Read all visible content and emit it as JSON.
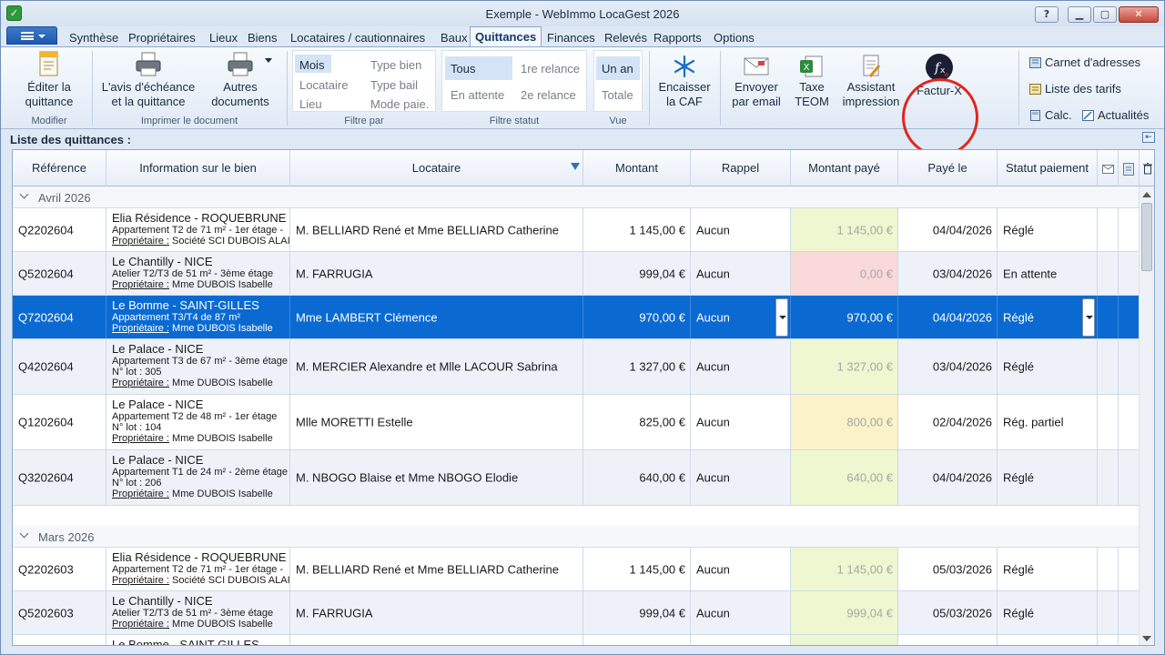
{
  "window": {
    "title": "Exemple - WebImmo LocaGest 2026",
    "help": "?",
    "minimize": "▁",
    "maximize": "▢",
    "close": "✕"
  },
  "tabs": [
    "Synthèse",
    "Propriétaires",
    "Lieux",
    "Biens",
    "Locataires / cautionnaires",
    "Baux",
    "Quittances",
    "Finances",
    "Relevés",
    "Rapports",
    "Options"
  ],
  "active_tab": "Quittances",
  "ribbon": {
    "modifier": {
      "label": "Modifier",
      "edit_l1": "Éditer la",
      "edit_l2": "quittance"
    },
    "imprimer": {
      "label": "Imprimer le document",
      "avis_l1": "L'avis d'échéance",
      "avis_l2": "et la quittance",
      "autres_l1": "Autres",
      "autres_l2": "documents"
    },
    "filtre_par": {
      "label": "Filtre par",
      "mois": "Mois",
      "locataire": "Locataire",
      "lieu": "Lieu",
      "type_bien": "Type bien",
      "type_bail": "Type bail",
      "mode_paie": "Mode paie."
    },
    "filtre_statut": {
      "label": "Filtre statut",
      "tous": "Tous",
      "en_attente": "En attente",
      "relance1": "1re relance",
      "relance2": "2e relance"
    },
    "vue": {
      "label": "Vue",
      "un_an": "Un an",
      "totale": "Totale"
    },
    "caf_l1": "Encaisser",
    "caf_l2": "la CAF",
    "email_l1": "Envoyer",
    "email_l2": "par email",
    "teom_l1": "Taxe",
    "teom_l2": "TEOM",
    "assist_l1": "Assistant",
    "assist_l2": "impression",
    "facturx": "Factur-X",
    "carnet": "Carnet d'adresses",
    "tarifs": "Liste des tarifs",
    "calc": "Calc.",
    "actualites": "Actualités"
  },
  "list_title": "Liste des quittances :",
  "columns": {
    "reference": "Référence",
    "info": "Information sur le bien",
    "locataire": "Locataire",
    "montant": "Montant",
    "rappel": "Rappel",
    "montant_paye": "Montant payé",
    "paye_le": "Payé le",
    "statut": "Statut paiement"
  },
  "groups": [
    {
      "label": "Avril 2026",
      "rows": [
        {
          "ref": "Q2202604",
          "l1": "Elia Résidence - ROQUEBRUNE C",
          "l2": "Appartement T2 de 71 m² - 1er étage -",
          "l3": "",
          "owner_label": "Propriétaire :",
          "owner": "Société SCI DUBOIS ALAI",
          "locataire": "M. BELLIARD René et Mme BELLIARD Catherine",
          "montant": "1 145,00 €",
          "rappel": "Aucun",
          "paye": "1 145,00 €",
          "paye_color": "green",
          "date": "04/04/2026",
          "statut": "Réglé"
        },
        {
          "ref": "Q5202604",
          "l1": "Le Chantilly - NICE",
          "l2": "Atelier T2/T3 de 51 m² - 3ème étage",
          "l3": "",
          "owner_label": "Propriétaire :",
          "owner": "Mme DUBOIS Isabelle",
          "locataire": "M. FARRUGIA",
          "montant": "999,04 €",
          "rappel": "Aucun",
          "paye": "0,00 €",
          "paye_color": "red",
          "date": "03/04/2026",
          "statut": "En attente"
        },
        {
          "ref": "Q7202604",
          "l1": "Le Bomme - SAINT-GILLES",
          "l2": "Appartement T3/T4 de 87 m²",
          "l3": "",
          "owner_label": "Propriétaire :",
          "owner": "Mme DUBOIS Isabelle",
          "locataire": "Mme LAMBERT Clémence",
          "montant": "970,00 €",
          "rappel": "Aucun",
          "paye": "970,00 €",
          "paye_color": "none",
          "date": "04/04/2026",
          "statut": "Réglé",
          "selected": true
        },
        {
          "ref": "Q4202604",
          "l1": "Le Palace - NICE",
          "l2": "Appartement T3 de 67 m² - 3ème étage",
          "l3": "N° lot : 305",
          "owner_label": "Propriétaire :",
          "owner": "Mme DUBOIS Isabelle",
          "locataire": "M. MERCIER Alexandre et Mlle LACOUR Sabrina",
          "montant": "1 327,00 €",
          "rappel": "Aucun",
          "paye": "1 327,00 €",
          "paye_color": "green",
          "date": "03/04/2026",
          "statut": "Réglé"
        },
        {
          "ref": "Q1202604",
          "l1": "Le Palace - NICE",
          "l2": "Appartement T2 de 48 m² - 1er étage",
          "l3": "N° lot : 104",
          "owner_label": "Propriétaire :",
          "owner": "Mme DUBOIS Isabelle",
          "locataire": "Mlle MORETTI Estelle",
          "montant": "825,00 €",
          "rappel": "Aucun",
          "paye": "800,00 €",
          "paye_color": "yellow",
          "date": "02/04/2026",
          "statut": "Rég. partiel"
        },
        {
          "ref": "Q3202604",
          "l1": "Le Palace - NICE",
          "l2": "Appartement T1 de 24 m² - 2ème étage",
          "l3": "N° lot : 206",
          "owner_label": "Propriétaire :",
          "owner": "Mme DUBOIS Isabelle",
          "locataire": "M. NBOGO Blaise et Mme NBOGO Elodie",
          "montant": "640,00 €",
          "rappel": "Aucun",
          "paye": "640,00 €",
          "paye_color": "green",
          "date": "04/04/2026",
          "statut": "Réglé"
        }
      ]
    },
    {
      "label": "Mars 2026",
      "rows": [
        {
          "ref": "Q2202603",
          "l1": "Elia Résidence - ROQUEBRUNE C",
          "l2": "Appartement T2 de 71 m² - 1er étage -",
          "l3": "",
          "owner_label": "Propriétaire :",
          "owner": "Société SCI DUBOIS ALAI",
          "locataire": "M. BELLIARD René et Mme BELLIARD Catherine",
          "montant": "1 145,00 €",
          "rappel": "Aucun",
          "paye": "1 145,00 €",
          "paye_color": "green",
          "date": "05/03/2026",
          "statut": "Réglé"
        },
        {
          "ref": "Q5202603",
          "l1": "Le Chantilly - NICE",
          "l2": "Atelier T2/T3 de 51 m² - 3ème étage",
          "l3": "",
          "owner_label": "Propriétaire :",
          "owner": "Mme DUBOIS Isabelle",
          "locataire": "M. FARRUGIA",
          "montant": "999,04 €",
          "rappel": "Aucun",
          "paye": "999,04 €",
          "paye_color": "green",
          "date": "05/03/2026",
          "statut": "Réglé"
        },
        {
          "ref": "",
          "l1": "Le Bomme - SAINT-GILLES",
          "l2": "",
          "l3": "",
          "owner_label": "",
          "owner": "",
          "locataire": "",
          "montant": "",
          "rappel": "",
          "paye": "",
          "paye_color": "green",
          "date": "",
          "statut": ""
        }
      ]
    }
  ],
  "colors": {
    "accent": "#0a6ad2",
    "paid_green": "#eef7cf",
    "paid_red": "#f9d9d9",
    "paid_yellow": "#fbf2c8",
    "highlight_circle": "#e3261e"
  }
}
